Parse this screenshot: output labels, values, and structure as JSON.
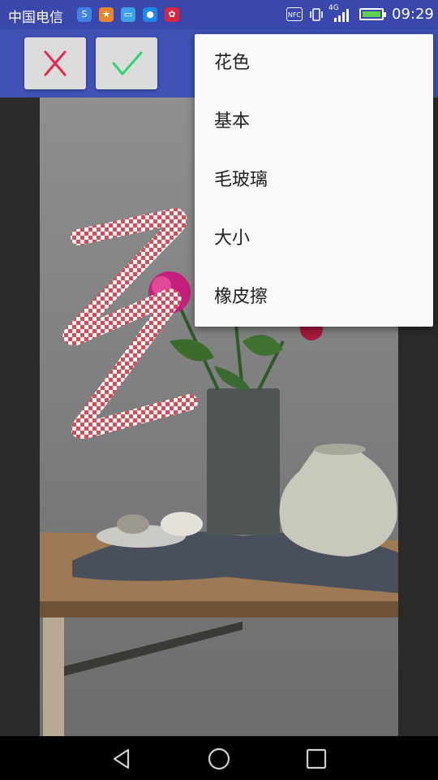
{
  "status_bar": {
    "carrier": "中国电信",
    "nfc_label": "NFC",
    "network": "4G",
    "time": "09:29",
    "battery_level": 1.0,
    "icons": [
      "sogou-icon",
      "fox-icon",
      "android-icon",
      "chat-icon",
      "huawei-icon"
    ]
  },
  "toolbar": {
    "cancel_icon": "close-icon",
    "confirm_icon": "check-icon",
    "cancel_color": "#e8294c",
    "confirm_color": "#2bd66a"
  },
  "menu": {
    "items": [
      {
        "label": "花色"
      },
      {
        "label": "基本"
      },
      {
        "label": "毛玻璃"
      },
      {
        "label": "大小"
      },
      {
        "label": "橡皮擦"
      }
    ]
  },
  "nav_bar": {
    "back_icon": "back-triangle-icon",
    "home_icon": "home-circle-icon",
    "recents_icon": "recents-square-icon"
  }
}
